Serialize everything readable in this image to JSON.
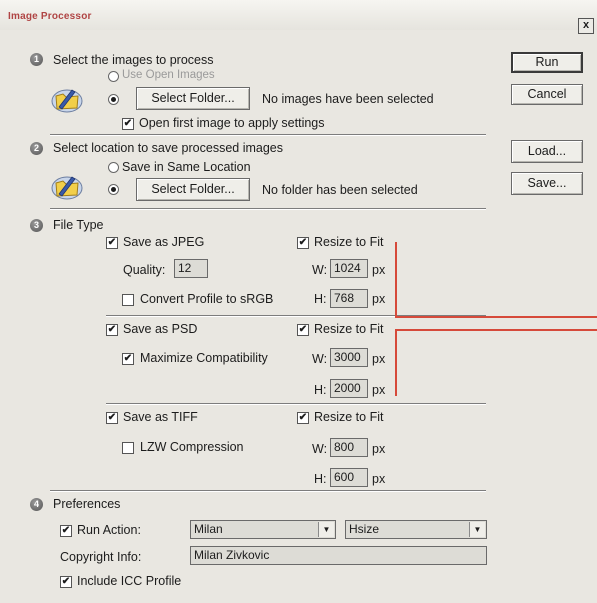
{
  "window": {
    "title": "Image Processor",
    "close": "x"
  },
  "buttons": {
    "run": "Run",
    "cancel": "Cancel",
    "load": "Load...",
    "save": "Save..."
  },
  "section1": {
    "num": "1",
    "heading": "Select the images to process",
    "use_open": "Use Open Images",
    "select_folder": "Select Folder...",
    "status": "No images have been selected",
    "open_first": "Open first image to apply settings"
  },
  "section2": {
    "num": "2",
    "heading": "Select location to save processed images",
    "same_location": "Save in Same Location",
    "select_folder": "Select Folder...",
    "status": "No folder has been selected"
  },
  "section3": {
    "num": "3",
    "heading": "File Type",
    "jpeg": {
      "save_label": "Save as JPEG",
      "resize_label": "Resize to Fit",
      "quality_label": "Quality:",
      "quality_value": "12",
      "convert_label": "Convert Profile to sRGB",
      "w_label": "W:",
      "w_value": "1024",
      "h_label": "H:",
      "h_value": "768",
      "unit": "px"
    },
    "psd": {
      "save_label": "Save as PSD",
      "resize_label": "Resize to Fit",
      "maximize_label": "Maximize Compatibility",
      "w_label": "W:",
      "w_value": "3000",
      "h_label": "H:",
      "h_value": "2000",
      "unit": "px"
    },
    "tiff": {
      "save_label": "Save as TIFF",
      "resize_label": "Resize to Fit",
      "lzw_label": "LZW Compression",
      "w_label": "W:",
      "w_value": "800",
      "h_label": "H:",
      "h_value": "600",
      "unit": "px"
    }
  },
  "section4": {
    "num": "4",
    "heading": "Preferences",
    "run_action_label": "Run Action:",
    "action_set": "Milan",
    "action_name": "Hsize",
    "copyright_label": "Copyright Info:",
    "copyright_value": "Milan Zivkovic",
    "icc_label": "Include ICC Profile"
  },
  "check_mark": "✔",
  "combo_arrow": "▼",
  "colors": {
    "title_text": "#b04444",
    "annotation": "#d64a3a",
    "background": "#e9e7e1"
  }
}
